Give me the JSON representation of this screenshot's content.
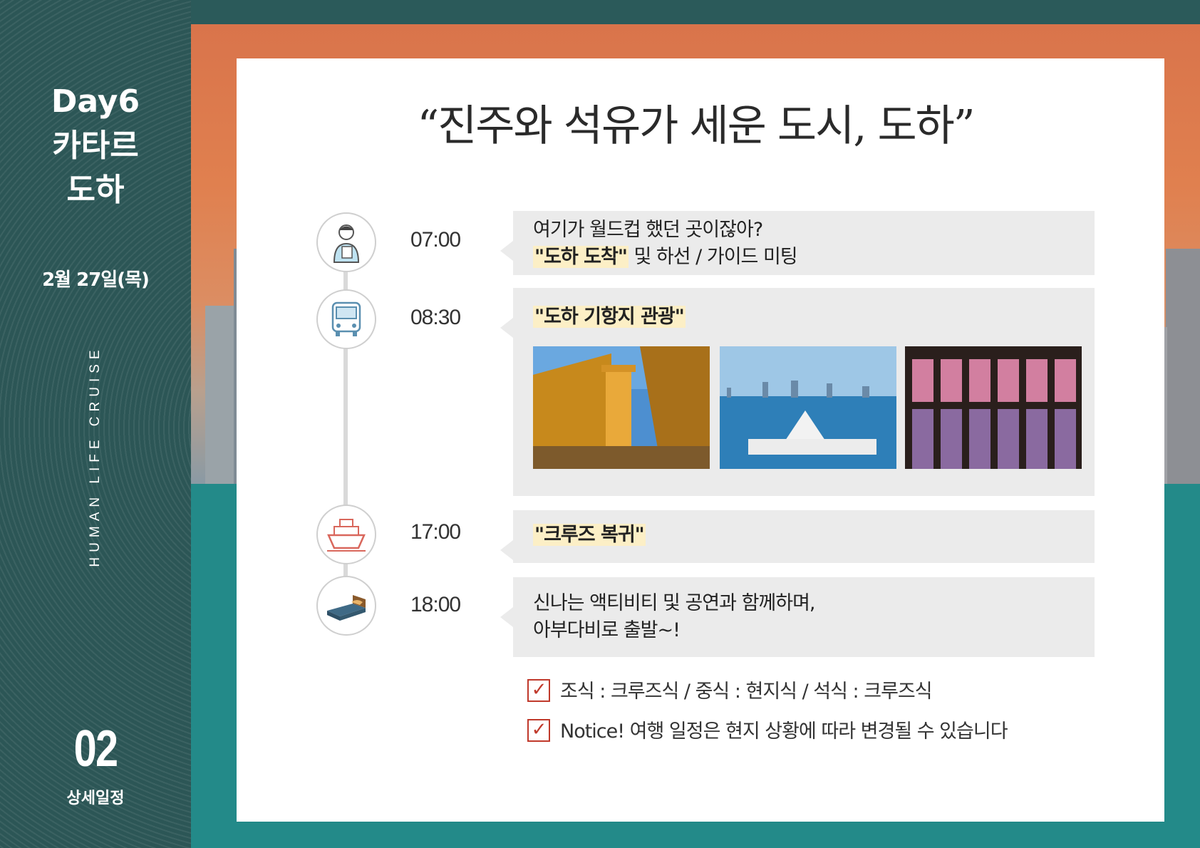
{
  "sidebar": {
    "day": "Day6",
    "country": "카타르",
    "city": "도하",
    "date": "2월 27일(목)",
    "brand": "HUMAN LIFE CRUISE",
    "page_number": "02",
    "page_label": "상세일정"
  },
  "title": "“진주와 석유가 세운 도시, 도하”",
  "schedule": [
    {
      "time": "07:00",
      "icon": "tour-guide-icon",
      "line1": "여기가 월드컵 했던 곳이잖아?",
      "highlight": "\"도하 도착\"",
      "rest": " 및 하선 / 가이드 미팅"
    },
    {
      "time": "08:30",
      "icon": "bus-icon",
      "highlight": "\"도하 기항지 관광\""
    },
    {
      "time": "17:00",
      "icon": "cruise-ship-icon",
      "highlight": "\"크루즈 복귀\""
    },
    {
      "time": "18:00",
      "icon": "bed-icon",
      "line1": "신나는 액티비티 및 공연과 함께하며,",
      "line2": "아부다비로 출발~!"
    }
  ],
  "checks": [
    {
      "text": "조식 : 크루즈식  /  중식 : 현지식  /  석식 : 크루즈식"
    },
    {
      "text": "Notice!  여행 일정은 현지 상황에 따라 변경될 수 있습니다"
    }
  ],
  "colors": {
    "sidebar": "#2c5656",
    "teal": "#238a89",
    "highlight": "#fcefc6",
    "check": "#c0392b"
  }
}
